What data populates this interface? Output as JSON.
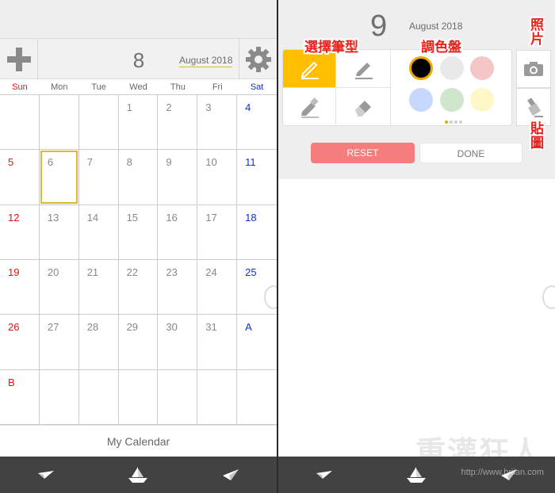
{
  "calendar": {
    "selected_day": "8",
    "month_label": "August 2018",
    "weekdays": [
      "Sun",
      "Mon",
      "Tue",
      "Wed",
      "Thu",
      "Fri",
      "Sat"
    ],
    "cells": [
      "",
      "",
      "",
      "1",
      "2",
      "3",
      "4",
      "5",
      "6",
      "7",
      "8",
      "9",
      "10",
      "11",
      "12",
      "13",
      "14",
      "15",
      "16",
      "17",
      "18",
      "19",
      "20",
      "21",
      "22",
      "23",
      "24",
      "25",
      "26",
      "27",
      "28",
      "29",
      "30",
      "31",
      "A",
      "B",
      "",
      "",
      "",
      "",
      "",
      ""
    ],
    "footer_label": "My Calendar",
    "weekend_colors": {
      "sun": "#e01414",
      "sat": "#1030c8"
    },
    "highlight_color": "#e3b731"
  },
  "editor": {
    "day": "9",
    "month_label": "August 2018",
    "pen_types": [
      {
        "icon": "pencil-icon",
        "active": true
      },
      {
        "icon": "marker-icon",
        "active": false
      },
      {
        "icon": "highlighter-icon",
        "active": false
      },
      {
        "icon": "eraser-icon",
        "active": false
      }
    ],
    "palette_colors": [
      "#000000",
      "#e9e9e9",
      "#f5c6c6",
      "#c6d8fb",
      "#cfe6cc",
      "#fff8c6"
    ],
    "selected_color": "#000000",
    "reset_label": "RESET",
    "done_label": "DONE",
    "side_tools": [
      "camera-icon",
      "stamp-icon"
    ],
    "accent_color": "#ffbf00"
  },
  "annotations": {
    "choose_pen": "選擇筆型",
    "palette": "調色盤",
    "photo": "照片",
    "sticker": "貼圖"
  },
  "watermark": {
    "text": "重灌狂人",
    "url": "http://www.briian.com"
  }
}
